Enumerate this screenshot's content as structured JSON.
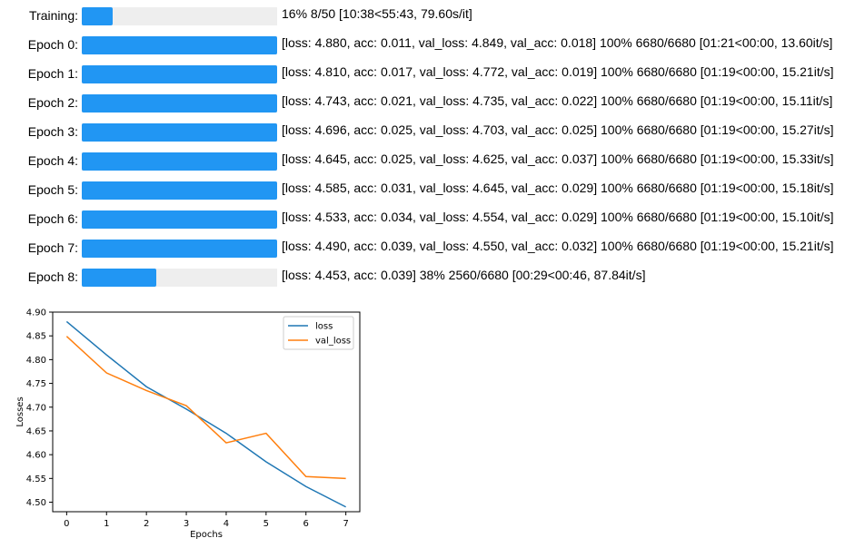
{
  "progress_rows": [
    {
      "label": "Training:",
      "progress": 0.16,
      "status": "16% 8/50 [10:38<55:43, 79.60s/it]"
    },
    {
      "label": "Epoch 0:",
      "progress": 1.0,
      "status": "[loss: 4.880, acc: 0.011, val_loss: 4.849, val_acc: 0.018] 100% 6680/6680 [01:21<00:00, 13.60it/s]"
    },
    {
      "label": "Epoch 1:",
      "progress": 1.0,
      "status": "[loss: 4.810, acc: 0.017, val_loss: 4.772, val_acc: 0.019] 100% 6680/6680 [01:19<00:00, 15.21it/s]"
    },
    {
      "label": "Epoch 2:",
      "progress": 1.0,
      "status": "[loss: 4.743, acc: 0.021, val_loss: 4.735, val_acc: 0.022] 100% 6680/6680 [01:19<00:00, 15.11it/s]"
    },
    {
      "label": "Epoch 3:",
      "progress": 1.0,
      "status": "[loss: 4.696, acc: 0.025, val_loss: 4.703, val_acc: 0.025] 100% 6680/6680 [01:19<00:00, 15.27it/s]"
    },
    {
      "label": "Epoch 4:",
      "progress": 1.0,
      "status": "[loss: 4.645, acc: 0.025, val_loss: 4.625, val_acc: 0.037] 100% 6680/6680 [01:19<00:00, 15.33it/s]"
    },
    {
      "label": "Epoch 5:",
      "progress": 1.0,
      "status": "[loss: 4.585, acc: 0.031, val_loss: 4.645, val_acc: 0.029] 100% 6680/6680 [01:19<00:00, 15.18it/s]"
    },
    {
      "label": "Epoch 6:",
      "progress": 1.0,
      "status": "[loss: 4.533, acc: 0.034, val_loss: 4.554, val_acc: 0.029] 100% 6680/6680 [01:19<00:00, 15.10it/s]"
    },
    {
      "label": "Epoch 7:",
      "progress": 1.0,
      "status": "[loss: 4.490, acc: 0.039, val_loss: 4.550, val_acc: 0.032] 100% 6680/6680 [01:19<00:00, 15.21it/s]"
    },
    {
      "label": "Epoch 8:",
      "progress": 0.38,
      "status": "[loss: 4.453, acc: 0.039] 38% 2560/6680 [00:29<00:46, 87.84it/s]"
    }
  ],
  "colors": {
    "bar_fill": "#2196f3",
    "bar_track": "#eeeeee"
  },
  "chart_data": {
    "type": "line",
    "title": "",
    "xlabel": "Epochs",
    "ylabel": "Losses",
    "x": [
      0,
      1,
      2,
      3,
      4,
      5,
      6,
      7
    ],
    "x_ticks": [
      "0",
      "1",
      "2",
      "3",
      "4",
      "5",
      "6",
      "7"
    ],
    "y_ticks": [
      "4.50",
      "4.55",
      "4.60",
      "4.65",
      "4.70",
      "4.75",
      "4.80",
      "4.85",
      "4.90"
    ],
    "xlim": [
      -0.35,
      7.35
    ],
    "ylim": [
      4.48,
      4.9
    ],
    "grid": false,
    "legend_position": "upper right",
    "series": [
      {
        "name": "loss",
        "color": "#1f77b4",
        "values": [
          4.88,
          4.81,
          4.743,
          4.696,
          4.645,
          4.585,
          4.533,
          4.49
        ]
      },
      {
        "name": "val_loss",
        "color": "#ff7f0e",
        "values": [
          4.849,
          4.772,
          4.735,
          4.703,
          4.625,
          4.645,
          4.554,
          4.55
        ]
      }
    ]
  }
}
